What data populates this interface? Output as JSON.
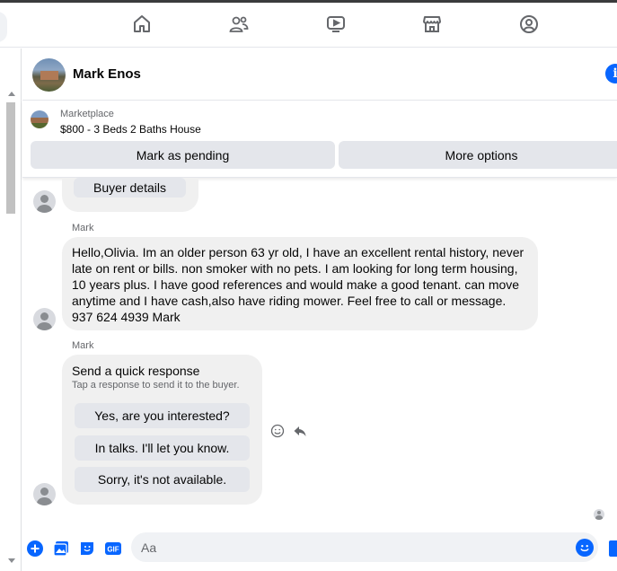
{
  "nav": {
    "icons": [
      "home-icon",
      "friends-icon",
      "watch-icon",
      "marketplace-icon",
      "groups-icon"
    ]
  },
  "header": {
    "contact_name": "Mark Enos"
  },
  "marketplace": {
    "label": "Marketplace",
    "listing_title": "$800 - 3 Beds 2 Baths House",
    "pending_button": "Mark as pending",
    "more_button": "More options"
  },
  "messages": {
    "buyer_details_button": "Buyer details",
    "sender_1": "Mark",
    "text": "Hello,Olivia.    Im an older person 63 yr old, I have an excellent rental history, never late on rent or bills. non smoker with no pets. I am looking for long term housing,  10 years plus. I have good references and would make a good tenant. can move anytime and I have cash,also have riding mower.  Feel free to call or message.    937 624 4939 Mark",
    "sender_2": "Mark",
    "quick_response": {
      "title": "Send a quick response",
      "subtitle": "Tap a response to send it to the buyer.",
      "options": [
        "Yes, are you interested?",
        "In talks. I'll let you know.",
        "Sorry, it's not available."
      ]
    }
  },
  "composer": {
    "placeholder": "Aa"
  },
  "colors": {
    "accent": "#0866ff",
    "bubble": "#f0f0f0",
    "button": "#e4e6eb"
  }
}
